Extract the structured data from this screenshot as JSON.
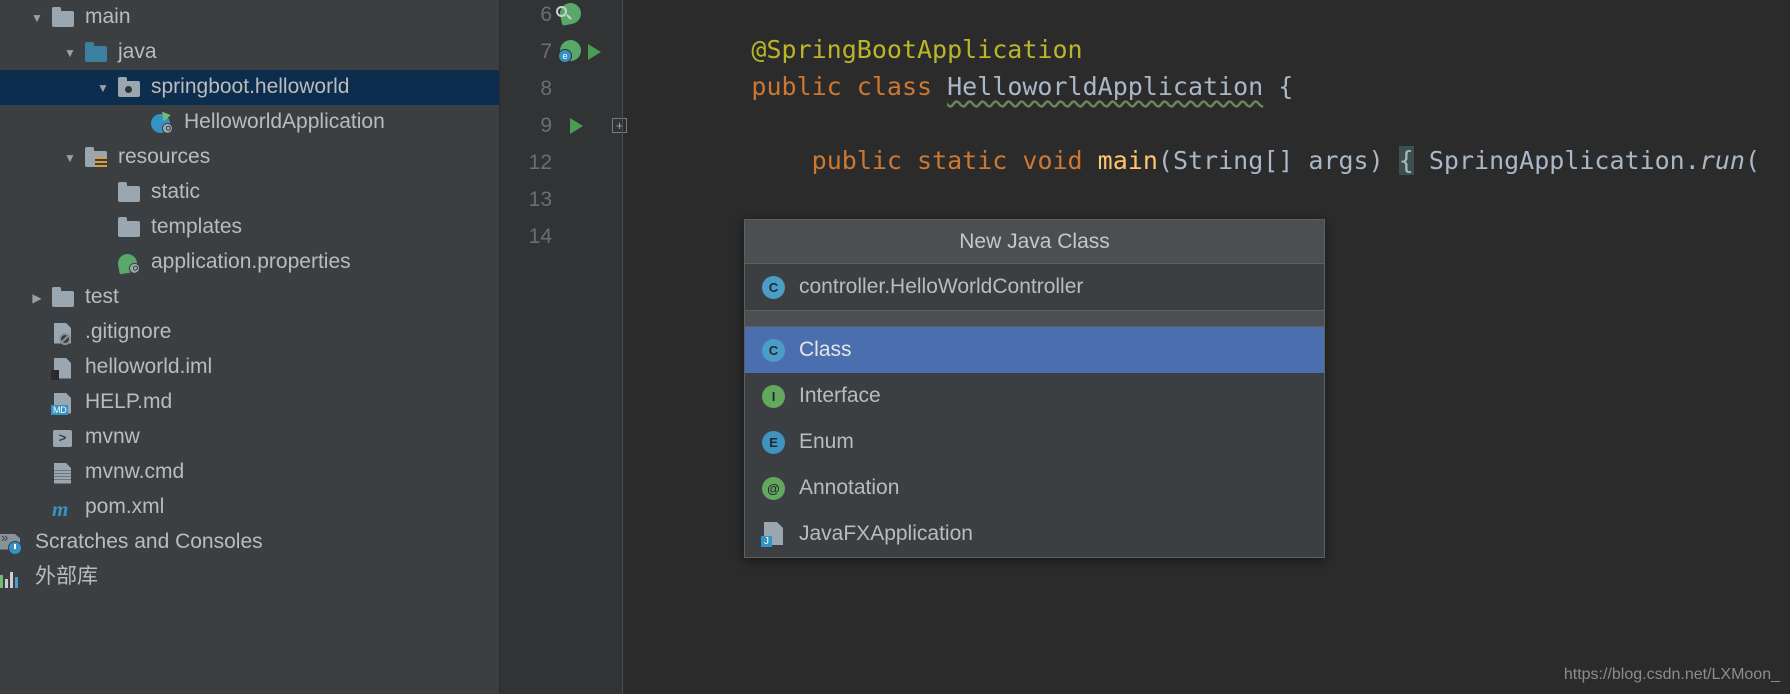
{
  "sidebar": {
    "items": [
      {
        "label": "main",
        "indent": 0,
        "arrow": "down",
        "icon": "folder-icon",
        "selected": false
      },
      {
        "label": "java",
        "indent": 1,
        "arrow": "down",
        "icon": "folder-blue-icon",
        "selected": false
      },
      {
        "label": "springboot.helloworld",
        "indent": 2,
        "arrow": "down",
        "icon": "package-folder-icon",
        "selected": true
      },
      {
        "label": "HelloworldApplication",
        "indent": 3,
        "arrow": "none",
        "icon": "spring-class-run-icon",
        "selected": false
      },
      {
        "label": "resources",
        "indent": 1,
        "arrow": "down",
        "icon": "resources-folder-icon",
        "selected": false
      },
      {
        "label": "static",
        "indent": 2,
        "arrow": "none",
        "icon": "folder-icon",
        "selected": false
      },
      {
        "label": "templates",
        "indent": 2,
        "arrow": "none",
        "icon": "folder-icon",
        "selected": false
      },
      {
        "label": "application.properties",
        "indent": 2,
        "arrow": "none",
        "icon": "spring-properties-icon",
        "selected": false
      },
      {
        "label": "test",
        "indent": 0,
        "arrow": "right",
        "icon": "folder-icon",
        "selected": false
      },
      {
        "label": ".gitignore",
        "indent": 0,
        "arrow": "none",
        "icon": "gitignore-file-icon",
        "selected": false
      },
      {
        "label": "helloworld.iml",
        "indent": 0,
        "arrow": "none",
        "icon": "iml-file-icon",
        "selected": false
      },
      {
        "label": "HELP.md",
        "indent": 0,
        "arrow": "none",
        "icon": "markdown-file-icon",
        "selected": false,
        "badge": "MD"
      },
      {
        "label": "mvnw",
        "indent": 0,
        "arrow": "none",
        "icon": "shell-script-icon",
        "selected": false
      },
      {
        "label": "mvnw.cmd",
        "indent": 0,
        "arrow": "none",
        "icon": "text-file-icon",
        "selected": false
      },
      {
        "label": "pom.xml",
        "indent": 0,
        "arrow": "none",
        "icon": "maven-file-icon",
        "selected": false
      },
      {
        "label": "Scratches and Consoles",
        "indent": -1,
        "arrow": "none",
        "icon": "scratches-icon",
        "selected": false
      },
      {
        "label": "外部库",
        "indent": -1,
        "arrow": "none",
        "icon": "external-libraries-icon",
        "selected": false
      }
    ]
  },
  "editor": {
    "lines": [
      {
        "number": "6",
        "icons": [
          "spring-bean-magnifier-icon"
        ]
      },
      {
        "number": "7",
        "icons": [
          "spring-bean-icon",
          "run-arrow-icon"
        ]
      },
      {
        "number": "8",
        "icons": []
      },
      {
        "number": "9",
        "icons": [
          "run-arrow-icon",
          "fold-expand-icon"
        ]
      },
      {
        "number": "12",
        "icons": []
      },
      {
        "number": "13",
        "icons": []
      },
      {
        "number": "14",
        "icons": []
      }
    ],
    "code": {
      "line6": "@SpringBootApplication",
      "line7_kw_public": "public",
      "line7_kw_class": "class",
      "line7_name": "HelloworldApplication",
      "line7_brace": "{",
      "line9_public": "public",
      "line9_static": "static",
      "line9_void": "void",
      "line9_main": "main",
      "line9_args": "(String[] args)",
      "line9_brace": "{",
      "line9_tail": "SpringApplication.",
      "line9_run": "run",
      "line9_paren": "(",
      "line13": "}"
    }
  },
  "popup": {
    "title": "New Java Class",
    "recent": [
      {
        "label": "controller.HelloWorldController",
        "icon": "class-icon"
      }
    ],
    "items": [
      {
        "label": "Class",
        "icon": "class-icon",
        "selected": true
      },
      {
        "label": "Interface",
        "icon": "interface-icon",
        "selected": false
      },
      {
        "label": "Enum",
        "icon": "enum-icon",
        "selected": false
      },
      {
        "label": "Annotation",
        "icon": "annotation-icon",
        "selected": false
      },
      {
        "label": "JavaFXApplication",
        "icon": "javafx-icon",
        "selected": false,
        "badge": "J"
      }
    ]
  },
  "watermark": {
    "text": "https://blog.csdn.net/LXMoon_"
  },
  "colors": {
    "sidebar_bg": "#3c3f41",
    "editor_bg": "#2b2b2b",
    "gutter_bg": "#313335",
    "selection_tree": "#0d2d4e",
    "selection_popup": "#4b6eaf",
    "annotation": "#bbb529",
    "keyword": "#cc7832",
    "method": "#ffc66d",
    "text": "#a9b7c6"
  }
}
